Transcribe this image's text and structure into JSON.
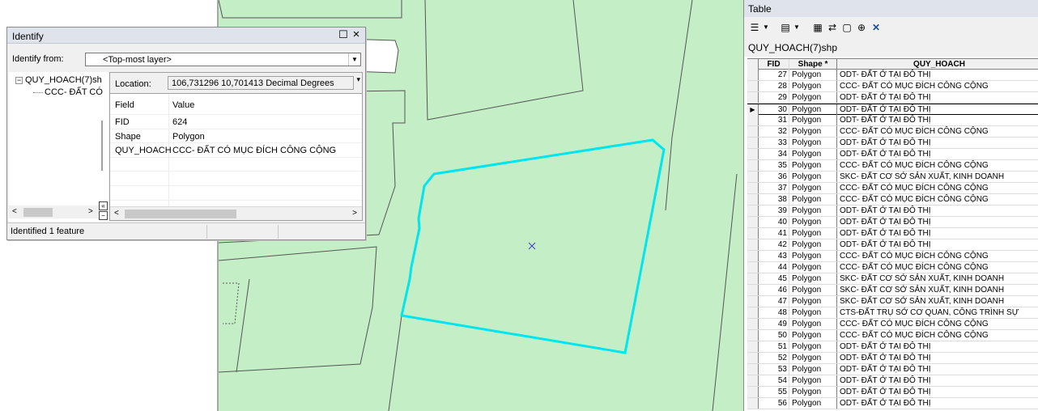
{
  "identify": {
    "title": "Identify",
    "minimize_glyph": "☐",
    "close_glyph": "×",
    "from_label": "Identify from:",
    "from_value": "<Top-most layer>",
    "tree": {
      "layer": "QUY_HOACH(7)sh",
      "feature": "CCC- ĐẤT CÓ"
    },
    "location_label": "Location:",
    "location_value": "106,731296  10,701413 Decimal Degrees",
    "columns": {
      "field": "Field",
      "value": "Value"
    },
    "attributes": [
      {
        "field": "FID",
        "value": "624"
      },
      {
        "field": "Shape",
        "value": "Polygon"
      },
      {
        "field": "QUY_HOACH",
        "value": "CCC- ĐẤT CÓ MỤC ĐÍCH CÔNG CỘNG"
      }
    ],
    "status": "Identified 1 feature"
  },
  "table": {
    "title": "Table",
    "layer_tab": "QUY_HOACH(7)shp",
    "headers": {
      "fid": "FID",
      "shape": "Shape *",
      "quy_hoach": "QUY_HOACH"
    },
    "selected_row_index": 3,
    "rows": [
      {
        "fid": "27",
        "shape": "Polygon",
        "quy_hoach": "ODT- ĐẤT Ở TẠI ĐÔ THỊ"
      },
      {
        "fid": "28",
        "shape": "Polygon",
        "quy_hoach": "CCC- ĐẤT CÓ MỤC ĐÍCH CÔNG CỘNG"
      },
      {
        "fid": "29",
        "shape": "Polygon",
        "quy_hoach": "ODT- ĐẤT Ở TẠI ĐÔ THỊ"
      },
      {
        "fid": "30",
        "shape": "Polygon",
        "quy_hoach": "ODT- ĐẤT Ở TẠI ĐÔ THỊ"
      },
      {
        "fid": "31",
        "shape": "Polygon",
        "quy_hoach": "ODT- ĐẤT Ở TẠI ĐÔ THỊ"
      },
      {
        "fid": "32",
        "shape": "Polygon",
        "quy_hoach": "CCC- ĐẤT CÓ MỤC ĐÍCH CÔNG CỘNG"
      },
      {
        "fid": "33",
        "shape": "Polygon",
        "quy_hoach": "ODT- ĐẤT Ở TẠI ĐÔ THỊ"
      },
      {
        "fid": "34",
        "shape": "Polygon",
        "quy_hoach": "ODT- ĐẤT Ở TẠI ĐÔ THỊ"
      },
      {
        "fid": "35",
        "shape": "Polygon",
        "quy_hoach": "CCC- ĐẤT CÓ MỤC ĐÍCH CÔNG CỘNG"
      },
      {
        "fid": "36",
        "shape": "Polygon",
        "quy_hoach": "SKC- ĐẤT CƠ SỞ SẢN XUẤT, KINH DOANH"
      },
      {
        "fid": "37",
        "shape": "Polygon",
        "quy_hoach": "CCC- ĐẤT CÓ MỤC ĐÍCH CÔNG CỘNG"
      },
      {
        "fid": "38",
        "shape": "Polygon",
        "quy_hoach": "CCC- ĐẤT CÓ MỤC ĐÍCH CÔNG CỘNG"
      },
      {
        "fid": "39",
        "shape": "Polygon",
        "quy_hoach": "ODT- ĐẤT Ở TẠI ĐÔ THỊ"
      },
      {
        "fid": "40",
        "shape": "Polygon",
        "quy_hoach": "ODT- ĐẤT Ở TẠI ĐÔ THỊ"
      },
      {
        "fid": "41",
        "shape": "Polygon",
        "quy_hoach": "ODT- ĐẤT Ở TẠI ĐÔ THỊ"
      },
      {
        "fid": "42",
        "shape": "Polygon",
        "quy_hoach": "ODT- ĐẤT Ở TẠI ĐÔ THỊ"
      },
      {
        "fid": "43",
        "shape": "Polygon",
        "quy_hoach": "CCC- ĐẤT CÓ MỤC ĐÍCH CÔNG CỘNG"
      },
      {
        "fid": "44",
        "shape": "Polygon",
        "quy_hoach": "CCC- ĐẤT CÓ MỤC ĐÍCH CÔNG CỘNG"
      },
      {
        "fid": "45",
        "shape": "Polygon",
        "quy_hoach": "SKC- ĐẤT CƠ SỞ SẢN XUẤT, KINH DOANH"
      },
      {
        "fid": "46",
        "shape": "Polygon",
        "quy_hoach": "SKC- ĐẤT CƠ SỞ SẢN XUẤT, KINH DOANH"
      },
      {
        "fid": "47",
        "shape": "Polygon",
        "quy_hoach": "SKC- ĐẤT CƠ SỞ SẢN XUẤT, KINH DOANH"
      },
      {
        "fid": "48",
        "shape": "Polygon",
        "quy_hoach": "CTS-ĐẤT TRỤ SỞ CƠ QUAN, CÔNG TRÌNH SỰ"
      },
      {
        "fid": "49",
        "shape": "Polygon",
        "quy_hoach": "CCC- ĐẤT CÓ MỤC ĐÍCH CÔNG CỘNG"
      },
      {
        "fid": "50",
        "shape": "Polygon",
        "quy_hoach": "CCC- ĐẤT CÓ MỤC ĐÍCH CÔNG CỘNG"
      },
      {
        "fid": "51",
        "shape": "Polygon",
        "quy_hoach": "ODT- ĐẤT Ở TẠI ĐÔ THỊ"
      },
      {
        "fid": "52",
        "shape": "Polygon",
        "quy_hoach": "ODT- ĐẤT Ở TẠI ĐÔ THỊ"
      },
      {
        "fid": "53",
        "shape": "Polygon",
        "quy_hoach": "ODT- ĐẤT Ở TẠI ĐÔ THỊ"
      },
      {
        "fid": "54",
        "shape": "Polygon",
        "quy_hoach": "ODT- ĐẤT Ở TẠI ĐÔ THỊ"
      },
      {
        "fid": "55",
        "shape": "Polygon",
        "quy_hoach": "ODT- ĐẤT Ở TẠI ĐÔ THỊ"
      },
      {
        "fid": "56",
        "shape": "Polygon",
        "quy_hoach": "ODT- ĐẤT Ở TẠI ĐÔ THỊ"
      }
    ]
  },
  "colors": {
    "map_fill": "#c4eec6",
    "selection_outline": "#00e5ee",
    "identify_marker": "#3b3bc8"
  }
}
